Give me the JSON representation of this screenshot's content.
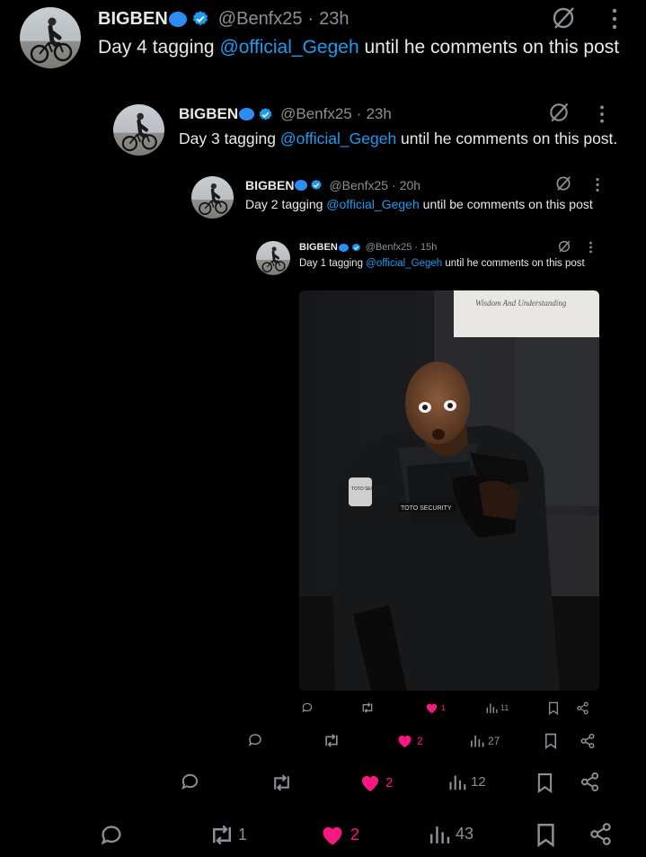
{
  "tweets": [
    {
      "name": "BIGBEN",
      "handle": "@Benfx25",
      "dot": "·",
      "time": "23h",
      "text_day": "Day 4 tagging ",
      "mention": "@official_Gegeh",
      "text_rest": " until he comments on this post",
      "stats": {
        "replies": "",
        "reposts": "1",
        "likes": "2",
        "views": "43"
      }
    },
    {
      "name": "BIGBEN",
      "handle": "@Benfx25",
      "dot": "·",
      "time": "23h",
      "text_day": "Day 3 tagging ",
      "mention": "@official_Gegeh",
      "text_rest": " until he comments on this post.",
      "stats": {
        "replies": "",
        "reposts": "",
        "likes": "2",
        "views": "12"
      }
    },
    {
      "name": "BIGBEN",
      "handle": "@Benfx25",
      "dot": "·",
      "time": "20h",
      "text_day": "Day 2 tagging ",
      "mention": "@official_Gegeh",
      "text_rest": " until be comments on this post",
      "stats": {
        "replies": "",
        "reposts": "",
        "likes": "2",
        "views": "27"
      }
    },
    {
      "name": "BIGBEN",
      "handle": "@Benfx25",
      "dot": "·",
      "time": "15h",
      "text_day": "Day 1 tagging ",
      "mention": "@official_Gegeh",
      "text_rest": " until he comments on this post",
      "stats": {
        "replies": "",
        "reposts": "",
        "likes": "1",
        "views": "11"
      }
    }
  ],
  "photo": {
    "sign_text": "Wisdom And Understanding",
    "badge_text": "TOTO SECURITY",
    "patch_text": "TOTO SECURITY"
  },
  "colors": {
    "background": "#000000",
    "text": "#e7e9ea",
    "muted": "#8b9096",
    "link": "#1d9bf0",
    "like": "#f91880",
    "verified": "#1d9bf0",
    "emoji_bubble": "#2b8ef7"
  },
  "icons": [
    "grok-icon",
    "more-icon",
    "reply-icon",
    "repost-icon",
    "heart-icon",
    "views-icon",
    "bookmark-icon",
    "share-icon",
    "verified-badge-icon",
    "speech-bubble-emoji-icon"
  ]
}
